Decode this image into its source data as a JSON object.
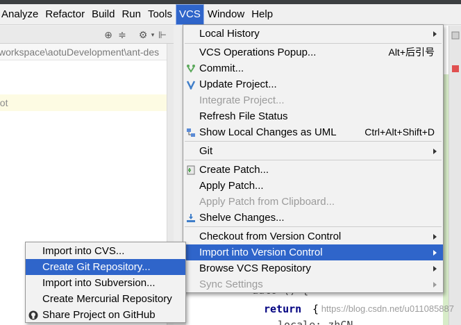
{
  "menubar": {
    "items": [
      "Analyze",
      "Refactor",
      "Build",
      "Run",
      "Tools",
      "VCS",
      "Window",
      "Help"
    ],
    "active": "VCS"
  },
  "project_panel": {
    "path": "workspace\\aotuDevelopment\\ant-des",
    "root_label": "oot"
  },
  "editor": {
    "line_fragment": "auto () {",
    "return_keyword": "return",
    "brace": "{",
    "locale_fragment": "locale: zhCN"
  },
  "vcs_menu": {
    "items": [
      {
        "label": "Local History",
        "shortcut": "",
        "submenu": true,
        "disabled": false,
        "icon": ""
      },
      {
        "label": "VCS Operations Popup...",
        "shortcut": "Alt+后引号",
        "submenu": false,
        "disabled": false,
        "icon": ""
      },
      {
        "label": "Commit...",
        "shortcut": "",
        "submenu": false,
        "disabled": false,
        "icon": "commit-icon"
      },
      {
        "label": "Update Project...",
        "shortcut": "",
        "submenu": false,
        "disabled": false,
        "icon": "update-icon"
      },
      {
        "label": "Integrate Project...",
        "shortcut": "",
        "submenu": false,
        "disabled": true,
        "icon": ""
      },
      {
        "label": "Refresh File Status",
        "shortcut": "",
        "submenu": false,
        "disabled": false,
        "icon": ""
      },
      {
        "label": "Show Local Changes as UML",
        "shortcut": "Ctrl+Alt+Shift+D",
        "submenu": false,
        "disabled": false,
        "icon": "uml-icon"
      },
      {
        "label": "Git",
        "shortcut": "",
        "submenu": true,
        "disabled": false,
        "icon": ""
      },
      {
        "label": "Create Patch...",
        "shortcut": "",
        "submenu": false,
        "disabled": false,
        "icon": "patch-icon"
      },
      {
        "label": "Apply Patch...",
        "shortcut": "",
        "submenu": false,
        "disabled": false,
        "icon": ""
      },
      {
        "label": "Apply Patch from Clipboard...",
        "shortcut": "",
        "submenu": false,
        "disabled": true,
        "icon": ""
      },
      {
        "label": "Shelve Changes...",
        "shortcut": "",
        "submenu": false,
        "disabled": false,
        "icon": "shelve-icon"
      },
      {
        "label": "Checkout from Version Control",
        "shortcut": "",
        "submenu": true,
        "disabled": false,
        "icon": ""
      },
      {
        "label": "Import into Version Control",
        "shortcut": "",
        "submenu": true,
        "disabled": false,
        "icon": "",
        "highlighted": true
      },
      {
        "label": "Browse VCS Repository",
        "shortcut": "",
        "submenu": true,
        "disabled": false,
        "icon": ""
      },
      {
        "label": "Sync Settings",
        "shortcut": "",
        "submenu": true,
        "disabled": true,
        "icon": ""
      }
    ]
  },
  "import_submenu": {
    "items": [
      {
        "label": "Import into CVS...",
        "highlighted": false,
        "icon": ""
      },
      {
        "label": "Create Git Repository...",
        "highlighted": true,
        "icon": ""
      },
      {
        "label": "Import into Subversion...",
        "highlighted": false,
        "icon": ""
      },
      {
        "label": "Create Mercurial Repository",
        "highlighted": false,
        "icon": ""
      },
      {
        "label": "Share Project on GitHub",
        "highlighted": false,
        "icon": "github-icon"
      }
    ]
  },
  "watermark": "https://blog.csdn.net/u011085887",
  "colors": {
    "highlight": "#2f65ca",
    "menu_bg": "#f2f2f2",
    "disabled_text": "#9b9b9b"
  }
}
